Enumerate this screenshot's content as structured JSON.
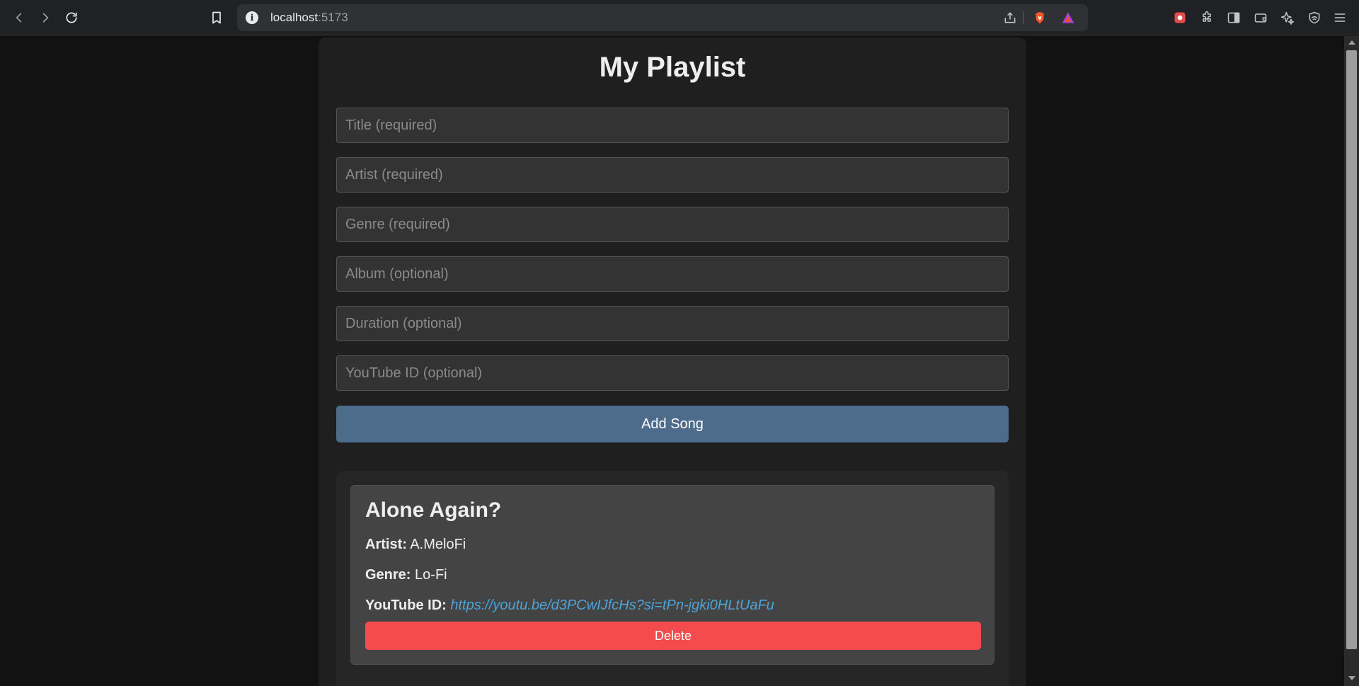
{
  "browser": {
    "url_host": "localhost",
    "url_port": ":5173"
  },
  "page": {
    "title": "My Playlist"
  },
  "form": {
    "title_placeholder": "Title (required)",
    "artist_placeholder": "Artist (required)",
    "genre_placeholder": "Genre (required)",
    "album_placeholder": "Album (optional)",
    "duration_placeholder": "Duration (optional)",
    "youtube_placeholder": "YouTube ID (optional)",
    "submit_label": "Add Song"
  },
  "songs": [
    {
      "title": "Alone Again?",
      "artist_label": "Artist:",
      "artist": "A.MeloFi",
      "genre_label": "Genre:",
      "genre": "Lo-Fi",
      "youtube_label": "YouTube ID:",
      "youtube": "https://youtu.be/d3PCwIJfcHs?si=tPn-jgki0HLtUaFu",
      "delete_label": "Delete"
    }
  ],
  "colors": {
    "accent_button": "#4d6b8a",
    "delete_button": "#f44b4e",
    "link": "#4ea3d8"
  }
}
